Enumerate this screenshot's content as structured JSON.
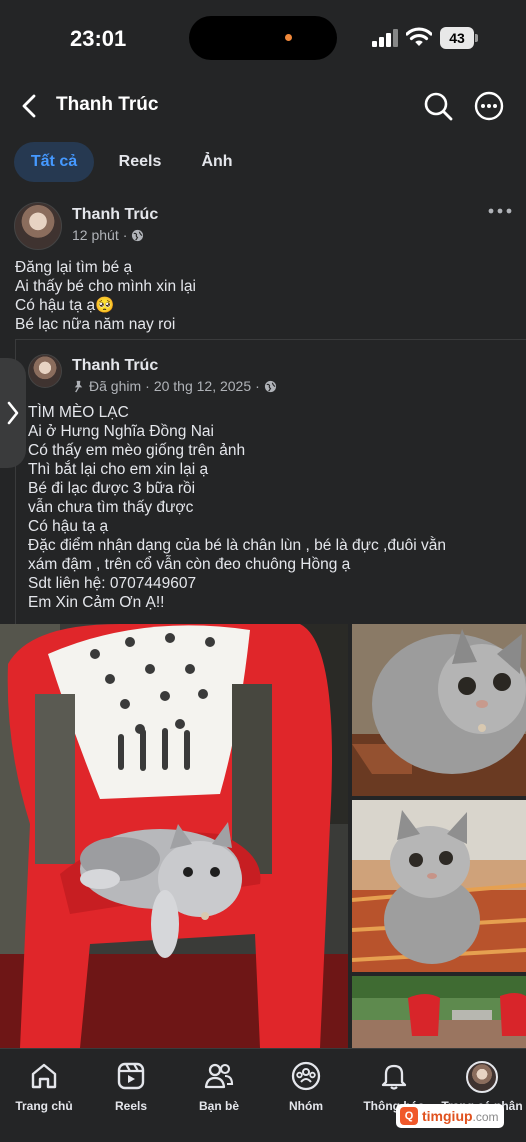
{
  "status_bar": {
    "time": "23:01",
    "battery": "43"
  },
  "header": {
    "title": "Thanh Trúc"
  },
  "tabs": [
    {
      "label": "Tất cả",
      "active": true
    },
    {
      "label": "Reels",
      "active": false
    },
    {
      "label": "Ảnh",
      "active": false
    }
  ],
  "post": {
    "author": "Thanh Trúc",
    "time": "12 phút",
    "text": "Đăng lại tìm bé ạ\nAi thấy bé cho mình xin lại\nCó hậu tạ ạ🥺\nBé lạc nữa năm nay roi",
    "shared": {
      "author": "Thanh Trúc",
      "pinned": "Đã ghim",
      "date": "20 thg 12, 2025",
      "text": "TÌM MÈO LẠC\nAi ở Hưng Nghĩa Đồng Nai\nCó thấy em mèo giống trên ảnh\nThì bắt lại cho em xin lại ạ\nBé đi lạc được 3 bữa rồi\nvẫn chưa tìm thấy được\nCó hậu tạ ạ\nĐặc điểm nhận dạng của bé là chân lùn , bé là đực ,đuôi vằn\nxám đậm , trên cổ vẫn còn đeo chuông Hồng ạ\nSdt liên hệ: 0707449607\nEm Xin Cảm Ơn Ạ!!"
    }
  },
  "bottom_nav": [
    {
      "label": "Trang chủ",
      "icon": "home-icon"
    },
    {
      "label": "Reels",
      "icon": "reels-icon"
    },
    {
      "label": "Bạn bè",
      "icon": "friends-icon"
    },
    {
      "label": "Nhóm",
      "icon": "groups-icon"
    },
    {
      "label": "Thông báo",
      "icon": "bell-icon"
    },
    {
      "label": "Trang cá nhân",
      "icon": "profile-avatar"
    }
  ],
  "watermark": {
    "brand": "timgiup",
    "suffix": ".com"
  },
  "colors": {
    "background": "#242526",
    "accent": "#4599ff",
    "tab_active_bg": "#263951",
    "text": "#e4e6eb",
    "muted": "#b0b3b8"
  }
}
